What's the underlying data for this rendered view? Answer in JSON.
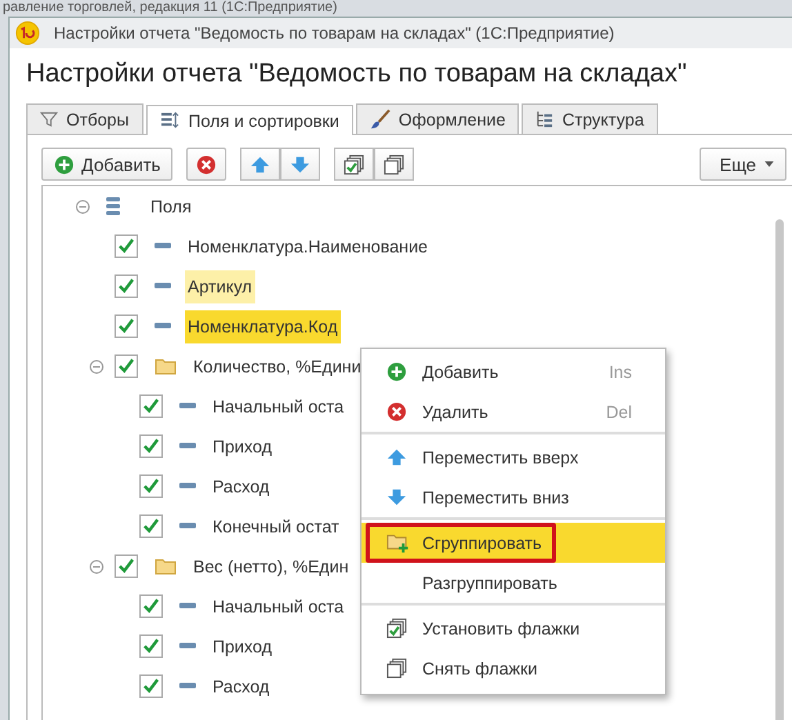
{
  "background_window": {
    "title": "равление торговлей, редакция 11 (1С:Предприятие)"
  },
  "window": {
    "title": "Настройки отчета \"Ведомость по товарам на складах\"  (1С:Предприятие)"
  },
  "heading": "Настройки отчета \"Ведомость по товарам на складах\"",
  "tabs": [
    {
      "label": "Отборы",
      "selected": false
    },
    {
      "label": "Поля и сортировки",
      "selected": true
    },
    {
      "label": "Оформление",
      "selected": false
    },
    {
      "label": "Структура",
      "selected": false
    }
  ],
  "toolbar": {
    "add": "Добавить",
    "more": "Еще"
  },
  "tree": {
    "label": "Поля",
    "expanded": true,
    "children": [
      {
        "kind": "field",
        "label": "Номенклатура.Наименование",
        "checked": true,
        "hovered": false,
        "selected": false
      },
      {
        "kind": "field",
        "label": "Артикул",
        "checked": true,
        "hovered": true,
        "selected": false
      },
      {
        "kind": "field",
        "label": "Номенклатура.Код",
        "checked": true,
        "hovered": false,
        "selected": true
      },
      {
        "kind": "group",
        "label": "Количество, %Едини",
        "checked": true,
        "expanded": true,
        "hovered": false,
        "selected": false,
        "children": [
          {
            "kind": "field",
            "label": "Начальный оста",
            "checked": true,
            "hovered": false,
            "selected": false
          },
          {
            "kind": "field",
            "label": "Приход",
            "checked": true,
            "hovered": false,
            "selected": false
          },
          {
            "kind": "field",
            "label": "Расход",
            "checked": true,
            "hovered": false,
            "selected": false
          },
          {
            "kind": "field",
            "label": "Конечный остат",
            "checked": true,
            "hovered": false,
            "selected": false
          }
        ]
      },
      {
        "kind": "group",
        "label": "Вес (нетто), %Един",
        "checked": true,
        "expanded": true,
        "hovered": false,
        "selected": false,
        "children": [
          {
            "kind": "field",
            "label": "Начальный оста",
            "checked": true,
            "hovered": false,
            "selected": false
          },
          {
            "kind": "field",
            "label": "Приход",
            "checked": true,
            "hovered": false,
            "selected": false
          },
          {
            "kind": "field",
            "label": "Расход",
            "checked": true,
            "hovered": false,
            "selected": false
          }
        ]
      }
    ]
  },
  "context_menu": [
    {
      "label": "Добавить",
      "shortcut": "Ins",
      "selected": false,
      "separator_after": false,
      "framed": false
    },
    {
      "label": "Удалить",
      "shortcut": "Del",
      "selected": false,
      "separator_after": true,
      "framed": false
    },
    {
      "label": "Переместить вверх",
      "selected": false,
      "separator_after": false,
      "framed": false
    },
    {
      "label": "Переместить вниз",
      "selected": false,
      "separator_after": true,
      "framed": false
    },
    {
      "label": "Сгруппировать",
      "selected": true,
      "separator_after": false,
      "framed": true
    },
    {
      "label": "Разгруппировать",
      "selected": false,
      "separator_after": true,
      "framed": false
    },
    {
      "label": "Установить флажки",
      "selected": false,
      "separator_after": false,
      "framed": false
    },
    {
      "label": "Снять флажки",
      "selected": false,
      "separator_after": false,
      "framed": false
    }
  ]
}
